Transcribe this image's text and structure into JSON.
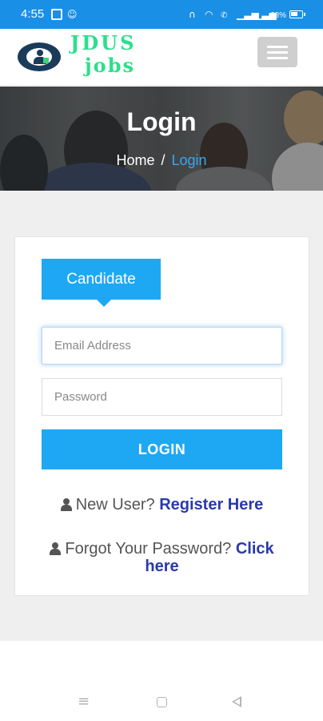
{
  "status_bar": {
    "time": "4:55",
    "battery_percent": "68%",
    "battery_level": 0.68
  },
  "navbar": {
    "logo_line1": "JDUS",
    "logo_line2": "jobs"
  },
  "banner": {
    "title": "Login",
    "breadcrumb_home": "Home",
    "breadcrumb_separator": "/",
    "breadcrumb_current": "Login"
  },
  "login_form": {
    "tab_label": "Candidate",
    "email_placeholder": "Email Address",
    "password_placeholder": "Password",
    "login_button": "LOGIN",
    "new_user_text": "New User?",
    "register_link": "Register Here",
    "forgot_text": "Forgot Your Password?",
    "click_link": "Click",
    "here_link": "here"
  },
  "colors": {
    "status_bar": "#1a8fe6",
    "accent": "#1ea8f4",
    "logo_green": "#2be08a",
    "link": "#2a3aa8",
    "breadcrumb_active": "#3aa6ef"
  },
  "icons": {
    "status": [
      "image-icon",
      "robot-icon",
      "headset-icon",
      "wifi-icon",
      "vowifi-icon",
      "signal-icon",
      "signal-icon",
      "battery-icon"
    ],
    "form": [
      "user-icon"
    ],
    "system_nav": [
      "menu-icon",
      "home-icon",
      "back-icon"
    ]
  }
}
